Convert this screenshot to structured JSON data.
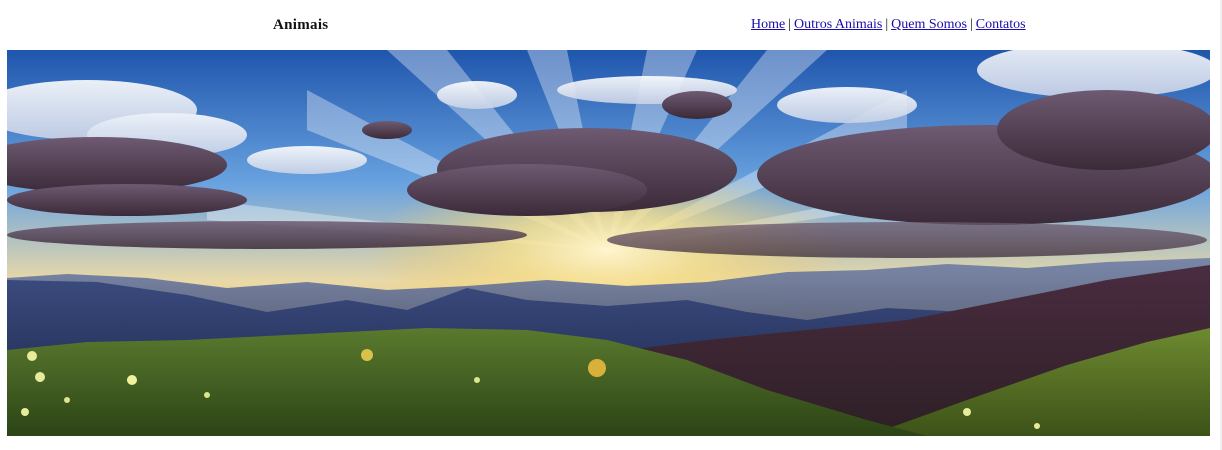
{
  "header": {
    "title": "Animais"
  },
  "nav": {
    "items": [
      {
        "label": "Home"
      },
      {
        "label": "Outros Animais"
      },
      {
        "label": "Quem Somos"
      },
      {
        "label": "Contatos"
      }
    ],
    "separator": "|"
  },
  "hero": {
    "image": "mountain-sunrise-landscape",
    "colors": {
      "sky_top": "#2a63b8",
      "sky_mid": "#7fb3e8",
      "sun_glow": "#f6d77a",
      "cloud_dark": "#4d3a4a",
      "mountain_far": "#3f4f7a",
      "hill_green": "#3d5a22"
    }
  }
}
